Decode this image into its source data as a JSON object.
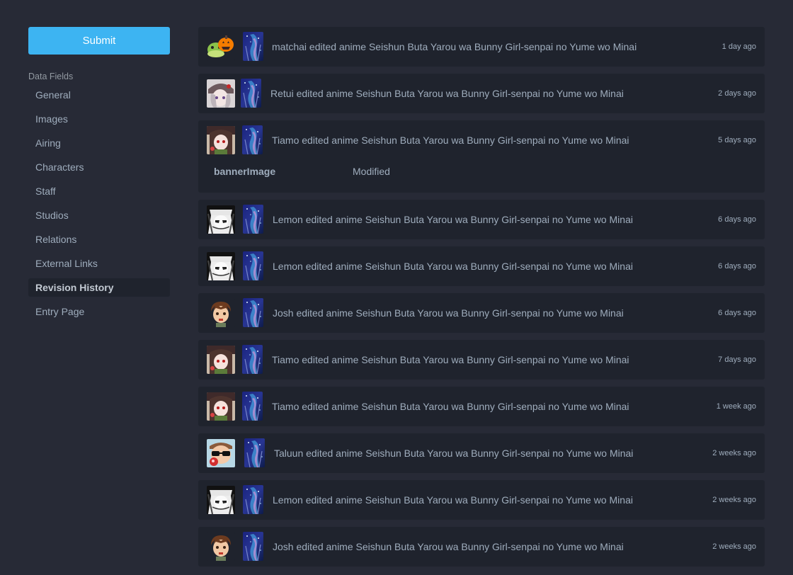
{
  "sidebar": {
    "submit_label": "Submit",
    "section_label": "Data Fields",
    "items": [
      {
        "label": "General"
      },
      {
        "label": "Images"
      },
      {
        "label": "Airing"
      },
      {
        "label": "Characters"
      },
      {
        "label": "Staff"
      },
      {
        "label": "Studios"
      },
      {
        "label": "Relations"
      },
      {
        "label": "External Links"
      },
      {
        "label": "Revision History",
        "active": true
      },
      {
        "label": "Entry Page"
      }
    ]
  },
  "colors": {
    "background": "#272a36",
    "card": "#1f232d",
    "accent": "#3db4f2",
    "text": "#9fadbd"
  },
  "feed": {
    "entries": [
      {
        "user": "matchai",
        "text": "matchai edited anime Seishun Buta Yarou wa Bunny Girl-senpai no Yume wo Minai",
        "time": "1 day ago",
        "avatar": "pumpkin-frog-avatar"
      },
      {
        "user": "Retui",
        "text": "Retui edited anime Seishun Buta Yarou wa Bunny Girl-senpai no Yume wo Minai",
        "time": "2 days ago",
        "avatar": "silver-hair-girl-avatar"
      },
      {
        "user": "Tiamo",
        "text": "Tiamo edited anime Seishun Buta Yarou wa Bunny Girl-senpai no Yume wo Minai",
        "time": "5 days ago",
        "avatar": "brown-hair-girl-avatar",
        "change": {
          "field": "bannerImage",
          "status": "Modified"
        }
      },
      {
        "user": "Lemon",
        "text": "Lemon edited anime Seishun Buta Yarou wa Bunny Girl-senpai no Yume wo Minai",
        "time": "6 days ago",
        "avatar": "monochrome-girl-avatar"
      },
      {
        "user": "Lemon",
        "text": "Lemon edited anime Seishun Buta Yarou wa Bunny Girl-senpai no Yume wo Minai",
        "time": "6 days ago",
        "avatar": "monochrome-girl-avatar"
      },
      {
        "user": "Josh",
        "text": "Josh edited anime Seishun Buta Yarou wa Bunny Girl-senpai no Yume wo Minai",
        "time": "6 days ago",
        "avatar": "brown-hair-boy-avatar"
      },
      {
        "user": "Tiamo",
        "text": "Tiamo edited anime Seishun Buta Yarou wa Bunny Girl-senpai no Yume wo Minai",
        "time": "7 days ago",
        "avatar": "brown-hair-girl-avatar"
      },
      {
        "user": "Tiamo",
        "text": "Tiamo edited anime Seishun Buta Yarou wa Bunny Girl-senpai no Yume wo Minai",
        "time": "1 week ago",
        "avatar": "brown-hair-girl-avatar"
      },
      {
        "user": "Taluun",
        "text": "Taluun edited anime Seishun Buta Yarou wa Bunny Girl-senpai no Yume wo Minai",
        "time": "2 weeks ago",
        "avatar": "sunglasses-guy-avatar"
      },
      {
        "user": "Lemon",
        "text": "Lemon edited anime Seishun Buta Yarou wa Bunny Girl-senpai no Yume wo Minai",
        "time": "2 weeks ago",
        "avatar": "monochrome-girl-avatar"
      },
      {
        "user": "Josh",
        "text": "Josh edited anime Seishun Buta Yarou wa Bunny Girl-senpai no Yume wo Minai",
        "time": "2 weeks ago",
        "avatar": "brown-hair-boy-avatar"
      }
    ]
  }
}
